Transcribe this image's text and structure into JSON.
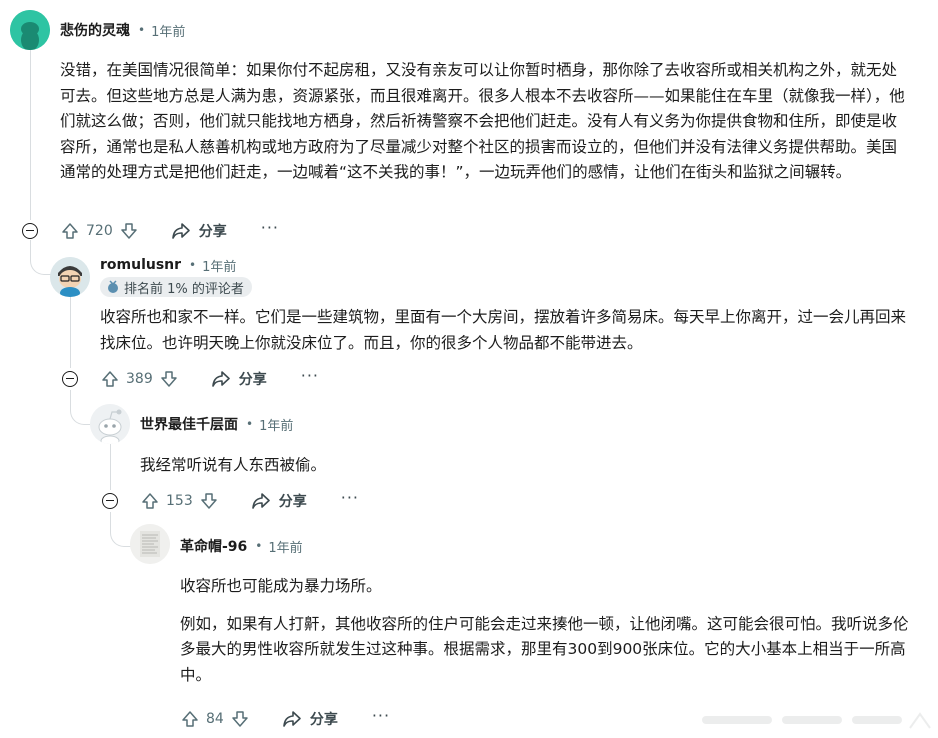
{
  "comments": [
    {
      "username": "悲伤的灵魂",
      "time": "1年前",
      "paragraphs": [
        "没错，在美国情况很简单：如果你付不起房租，又没有亲友可以让你暂时栖身，那你除了去收容所或相关机构之外，就无处可去。但这些地方总是人满为患，资源紧张，而且很难离开。很多人根本不去收容所——如果能住在车里（就像我一样），他们就这么做；否则，他们就只能找地方栖身，然后祈祷警察不会把他们赶走。没有人有义务为你提供食物和住所，即使是收容所，通常也是私人慈善机构或地方政府为了尽量减少对整个社区的损害而设立的，但他们并没有法律义务提供帮助。美国通常的处理方式是把他们赶走，一边喊着“这不关我的事！”，一边玩弄他们的感情，让他们在街头和监狱之间辗转。"
      ],
      "votes": "720",
      "share_label": "分享"
    },
    {
      "username": "romulusnr",
      "time": "1年前",
      "flair": "排名前 1% 的评论者",
      "paragraphs": [
        "收容所也和家不一样。它们是一些建筑物，里面有一个大房间，摆放着许多简易床。每天早上你离开，过一会儿再回来找床位。也许明天晚上你就没床位了。而且，你的很多个人物品都不能带进去。"
      ],
      "votes": "389",
      "share_label": "分享"
    },
    {
      "username": "世界最佳千层面",
      "time": "1年前",
      "paragraphs": [
        "我经常听说有人东西被偷。"
      ],
      "votes": "153",
      "share_label": "分享"
    },
    {
      "username": "革命帽-96",
      "time": "1年前",
      "paragraphs": [
        "收容所也可能成为暴力场所。",
        "例如，如果有人打鼾，其他收容所的住户可能会走过来揍他一顿，让他闭嘴。这可能会很可怕。我听说多伦多最大的男性收容所就发生过这种事。根据需求，那里有300到900张床位。它的大小基本上相当于一所高中。"
      ],
      "votes": "84",
      "share_label": "分享"
    }
  ],
  "dot": "•",
  "more_label": "···",
  "colors": {
    "meta": "#576f76",
    "thread_line": "#d9dde0",
    "flair_bg": "#eaedef",
    "avatar1": "#2ec4a3"
  },
  "icons": {
    "upvote": "arrow-up-icon",
    "downvote": "arrow-down-icon",
    "share": "share-icon",
    "collapse": "minus-circle-icon",
    "flair": "medal-icon",
    "more": "ellipsis-icon"
  }
}
